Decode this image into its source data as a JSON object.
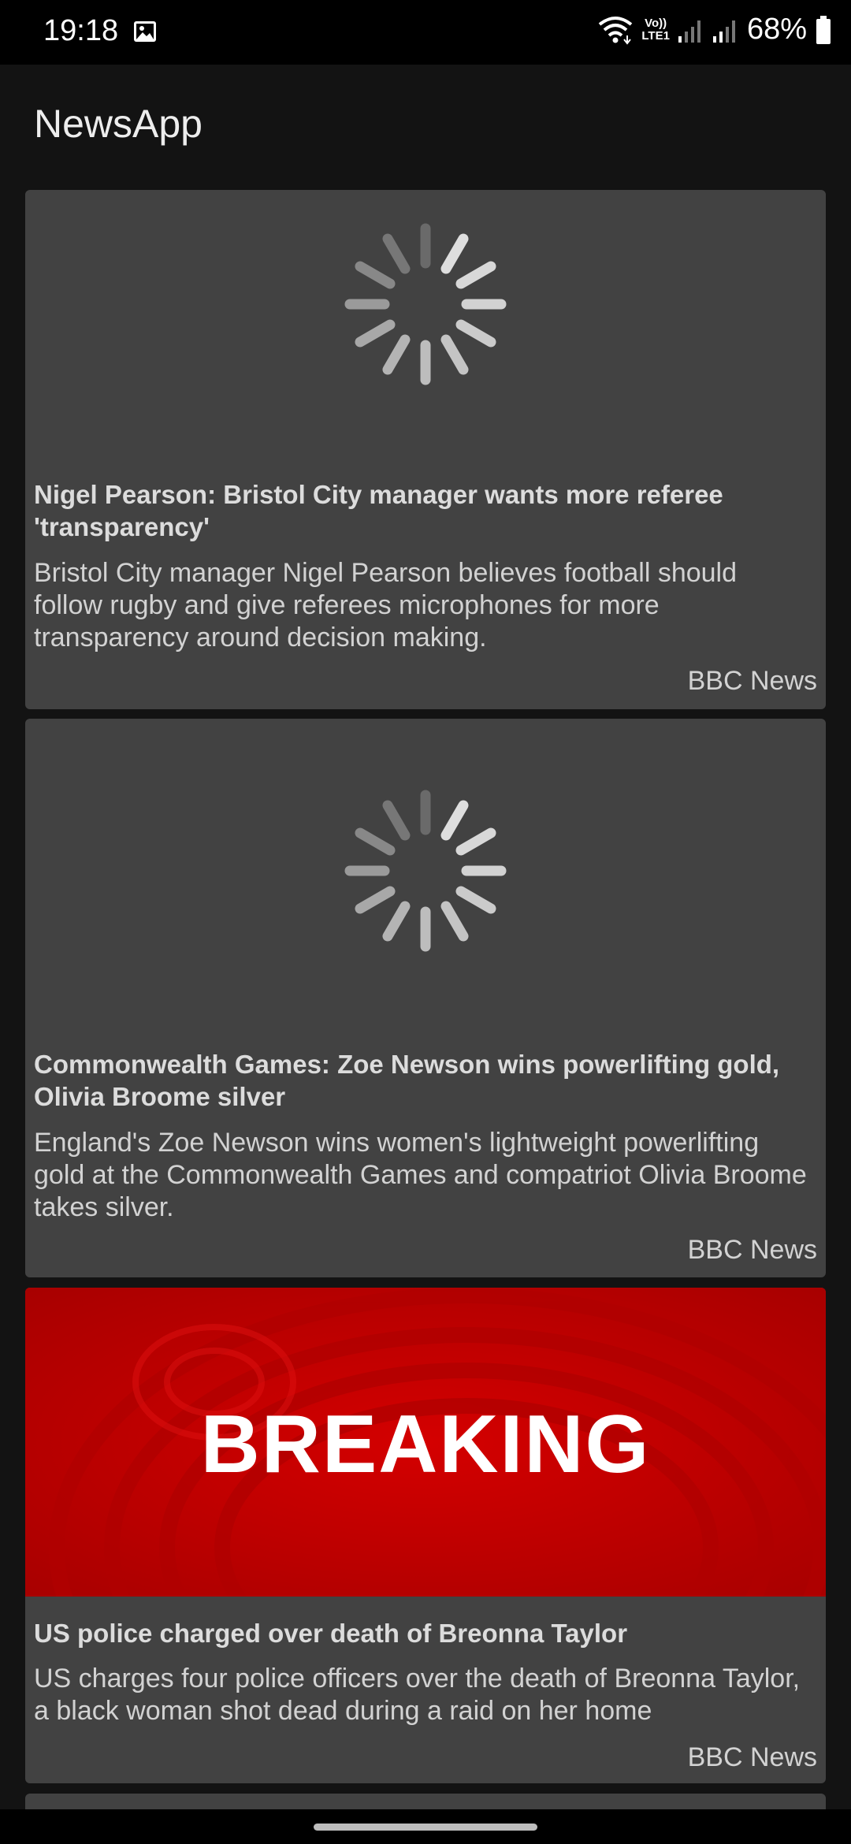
{
  "status_bar": {
    "time": "19:18",
    "battery": "68%",
    "lte_label": "LTE1",
    "volte_label": "Vo))",
    "icons": [
      "gallery-icon",
      "wifi-icon",
      "signal-icon",
      "battery-icon"
    ]
  },
  "app": {
    "title": "NewsApp"
  },
  "articles": [
    {
      "image": "loading",
      "title": "Nigel Pearson: Bristol City manager wants more referee 'transparency'",
      "description": "Bristol City manager Nigel Pearson believes football should follow rugby and give referees microphones for more transparency around decision making.",
      "source": "BBC News"
    },
    {
      "image": "loading",
      "title": "Commonwealth Games: Zoe Newson wins powerlifting gold, Olivia Broome silver",
      "description": "England's Zoe Newson wins women's lightweight powerlifting gold at the Commonwealth Games and compatriot Olivia Broome takes silver.",
      "source": "BBC News"
    },
    {
      "image": "breaking",
      "image_text": "BREAKING",
      "title": "US police charged over death of Breonna Taylor",
      "description": "US charges four police officers over the death of Breonna Taylor, a black woman shot dead during a raid on her home",
      "source": "BBC News"
    }
  ],
  "colors": {
    "background": "#131313",
    "card": "#424242",
    "breaking_red": "#c40000"
  }
}
